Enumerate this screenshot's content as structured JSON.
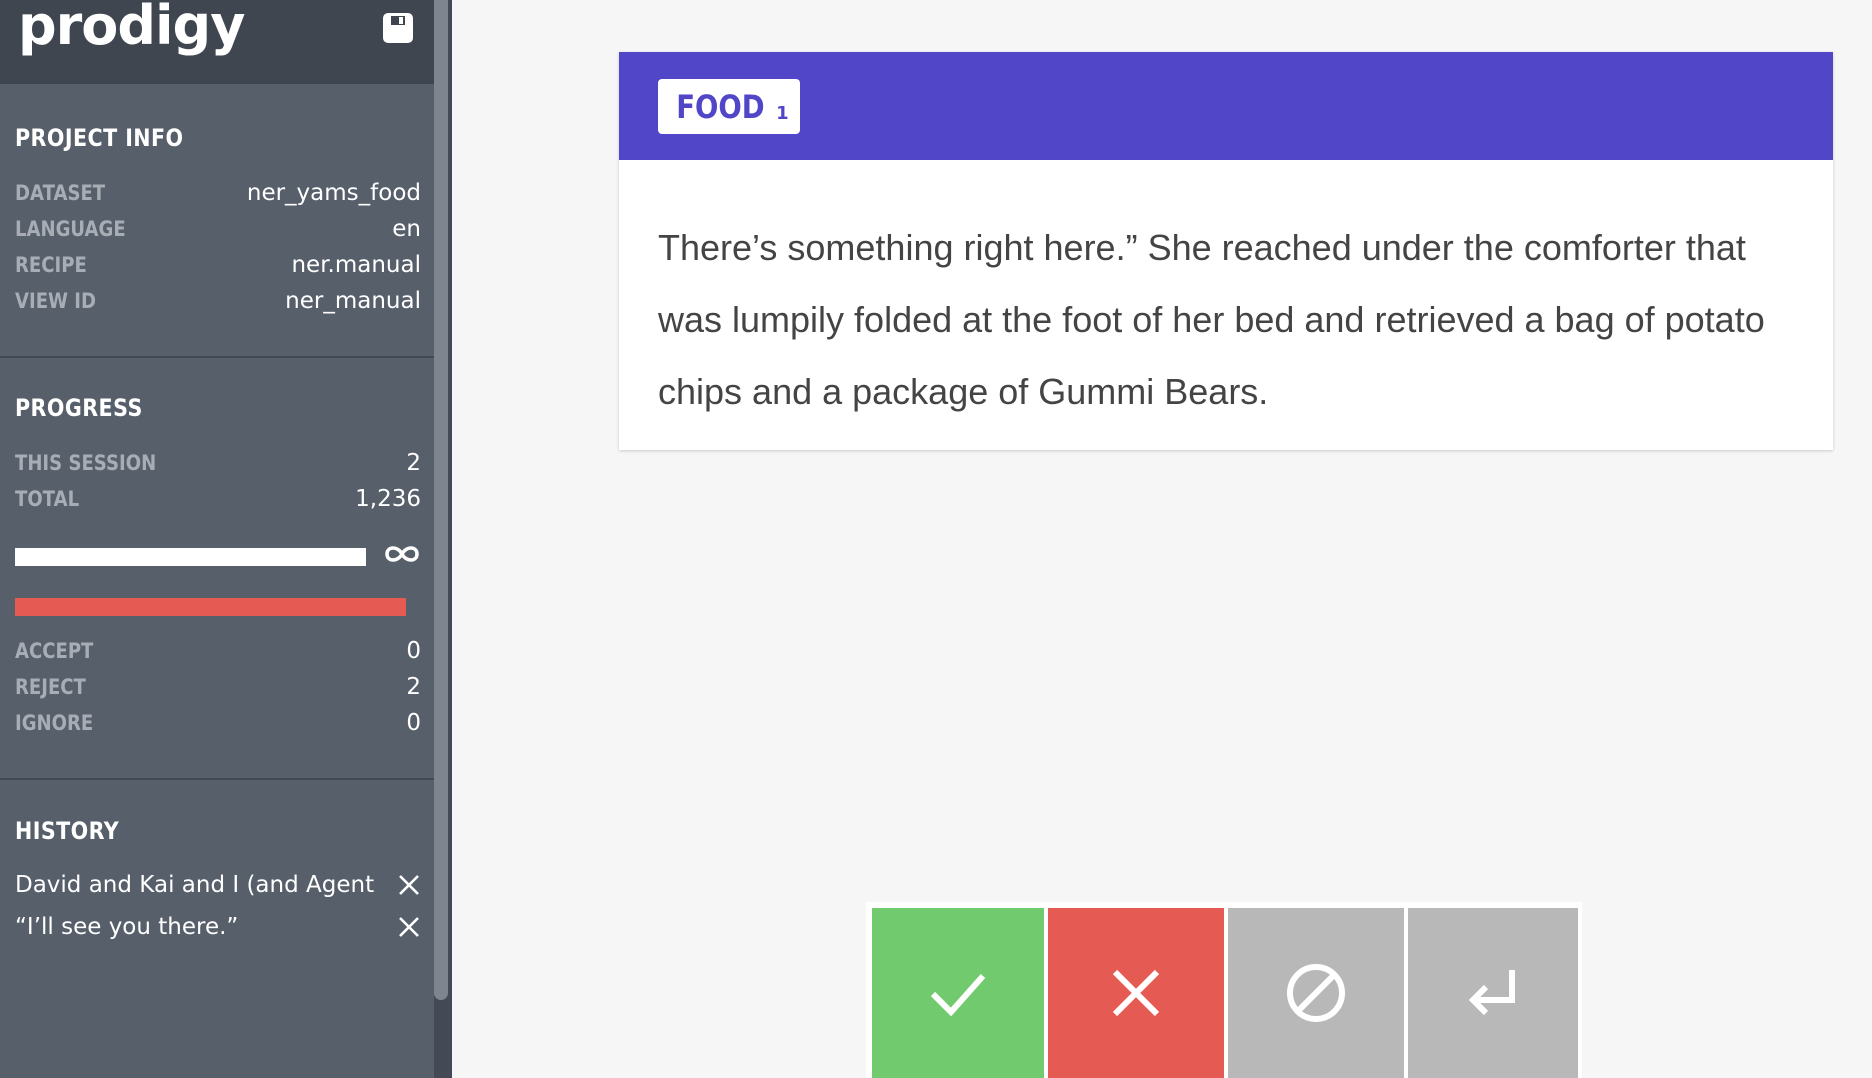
{
  "app": {
    "logo_text": "prodigy",
    "save_icon": "save-icon"
  },
  "project_info": {
    "title": "PROJECT INFO",
    "rows": [
      {
        "label": "DATASET",
        "value": "ner_yams_food"
      },
      {
        "label": "LANGUAGE",
        "value": "en"
      },
      {
        "label": "RECIPE",
        "value": "ner.manual"
      },
      {
        "label": "VIEW ID",
        "value": "ner_manual"
      }
    ]
  },
  "progress": {
    "title": "PROGRESS",
    "rows": [
      {
        "label": "THIS SESSION",
        "value": "2"
      },
      {
        "label": "TOTAL",
        "value": "1,236"
      }
    ],
    "progress_icon": "infinity-icon",
    "stats": [
      {
        "label": "ACCEPT",
        "value": "0"
      },
      {
        "label": "REJECT",
        "value": "2"
      },
      {
        "label": "IGNORE",
        "value": "0"
      }
    ]
  },
  "history": {
    "title": "HISTORY",
    "items": [
      {
        "text": "David and Kai and I (and Agent..."
      },
      {
        "text": "“I’ll see you there.”"
      }
    ]
  },
  "card": {
    "labels": [
      {
        "name": "FOOD",
        "key": "1",
        "color": "#5046c7"
      }
    ],
    "text": "There’s something right here.” She reached under the comforter that was lumpily folded at the foot of her bed and retrieved a bag of potato chips and a package of Gummi Bears."
  },
  "actions": [
    {
      "name": "accept",
      "icon": "check-icon",
      "color": "#72ca6f"
    },
    {
      "name": "reject",
      "icon": "close-icon",
      "color": "#e55a53"
    },
    {
      "name": "ignore",
      "icon": "no-entry-icon",
      "color": "#b8b8b8"
    },
    {
      "name": "undo",
      "icon": "return-icon",
      "color": "#b8b8b8"
    }
  ],
  "colors": {
    "sidebar_bg": "#575f6b",
    "sidebar_header_bg": "#3f4650",
    "accent": "#5046c7",
    "reject_red": "#e55a53",
    "accept_green": "#72ca6f"
  }
}
